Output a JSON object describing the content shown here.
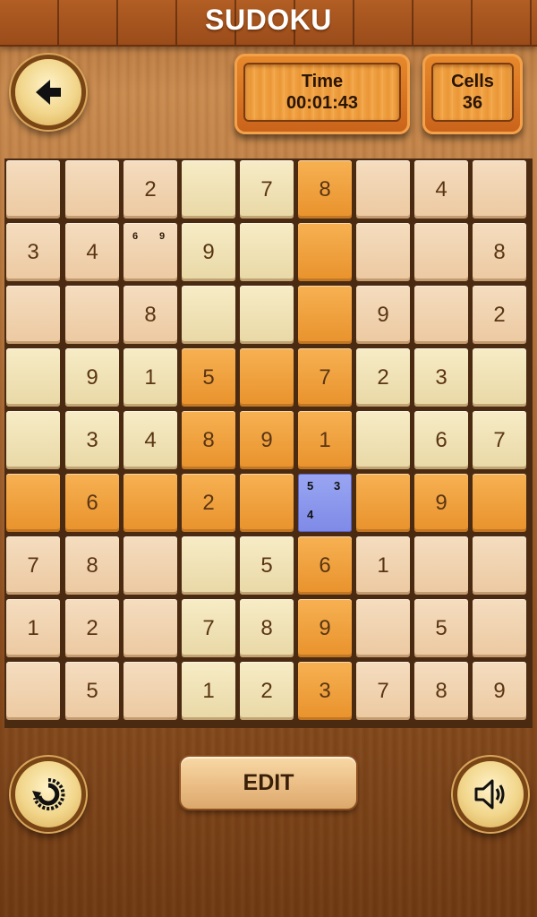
{
  "app": {
    "title": "SUDOKU"
  },
  "header": {
    "back_icon": "arrow-left-icon",
    "time": {
      "label": "Time",
      "value": "00:01:43"
    },
    "cells": {
      "label": "Cells",
      "value": "36"
    }
  },
  "board": {
    "grid": [
      [
        "",
        "",
        "2",
        "",
        "7",
        "8",
        "",
        "4",
        ""
      ],
      [
        "3",
        "4",
        "",
        "9",
        "",
        "",
        "",
        "",
        "8"
      ],
      [
        "",
        "",
        "8",
        "",
        "",
        "",
        "9",
        "",
        "2"
      ],
      [
        "",
        "9",
        "1",
        "5",
        "",
        "7",
        "2",
        "3",
        ""
      ],
      [
        "",
        "3",
        "4",
        "8",
        "9",
        "1",
        "",
        "6",
        "7"
      ],
      [
        "",
        "6",
        "",
        "2",
        "",
        "",
        "",
        "9",
        ""
      ],
      [
        "7",
        "8",
        "",
        "",
        "5",
        "6",
        "1",
        "",
        ""
      ],
      [
        "1",
        "2",
        "",
        "7",
        "8",
        "9",
        "",
        "5",
        ""
      ],
      [
        "",
        "5",
        "",
        "1",
        "2",
        "3",
        "7",
        "8",
        "9"
      ]
    ],
    "notes": [
      {
        "row": 1,
        "col": 2,
        "values": [
          "6",
          "9"
        ]
      },
      {
        "row": 5,
        "col": 5,
        "values": [
          "5",
          "3",
          "4"
        ]
      }
    ],
    "selected": {
      "row": 5,
      "col": 5
    },
    "colors": {
      "highlight": "#f0a040",
      "selected": "#8f9af0",
      "cell_light": "#f5dfc0",
      "cell_cream": "#f3e6bd"
    }
  },
  "footer": {
    "undo_icon": "undo-icon",
    "edit_label": "EDIT",
    "sound_icon": "speaker-icon"
  }
}
